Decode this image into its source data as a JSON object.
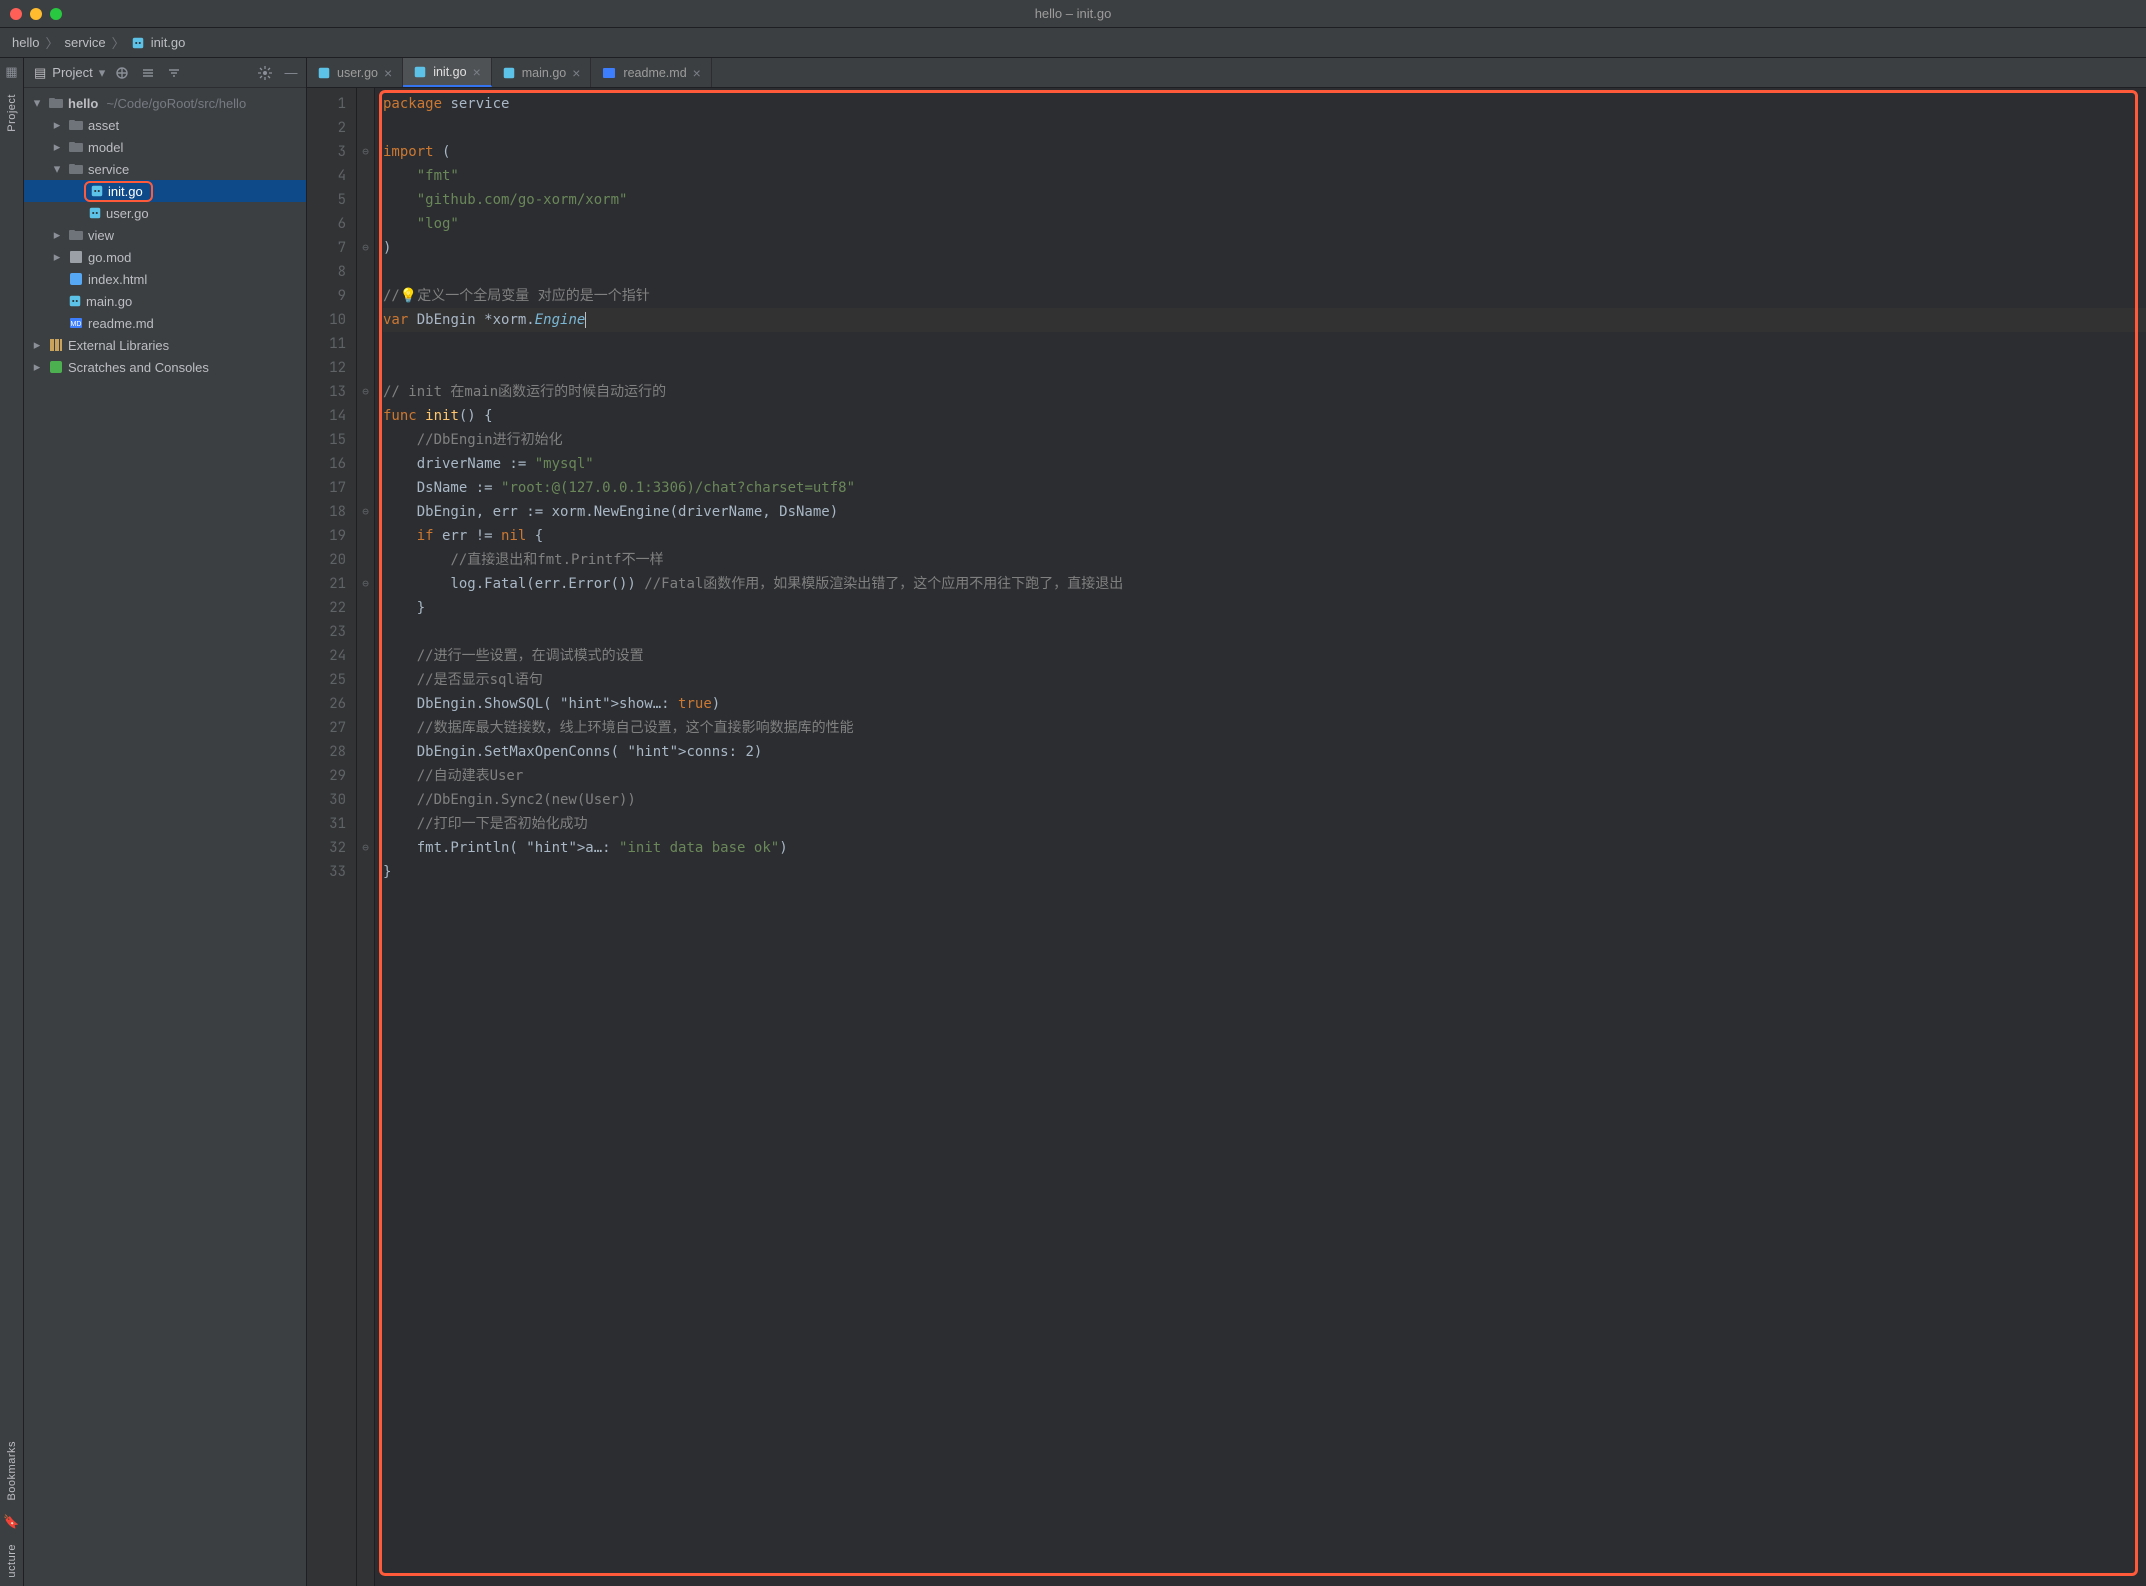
{
  "window": {
    "title": "hello – init.go"
  },
  "breadcrumb": {
    "root": "hello",
    "mid": "service",
    "file": "init.go"
  },
  "sidebar": {
    "title": "Project",
    "tree": {
      "root": {
        "name": "hello",
        "path": "~/Code/goRoot/src/hello"
      },
      "items": [
        {
          "name": "asset"
        },
        {
          "name": "model"
        },
        {
          "name": "service",
          "children": [
            {
              "name": "init.go"
            },
            {
              "name": "user.go"
            }
          ]
        },
        {
          "name": "view"
        },
        {
          "name": "go.mod"
        },
        {
          "name": "index.html"
        },
        {
          "name": "main.go"
        },
        {
          "name": "readme.md"
        }
      ],
      "external": "External Libraries",
      "scratches": "Scratches and Consoles"
    }
  },
  "tabs": [
    {
      "label": "user.go"
    },
    {
      "label": "init.go",
      "active": true
    },
    {
      "label": "main.go"
    },
    {
      "label": "readme.md"
    }
  ],
  "rail": {
    "project": "Project",
    "bookmarks": "Bookmarks",
    "structure": "ucture"
  },
  "code": {
    "lines": [
      "package service",
      "",
      "import (",
      "    \"fmt\"",
      "    \"github.com/go-xorm/xorm\"",
      "    \"log\"",
      ")",
      "",
      "//💡定义一个全局变量 对应的是一个指针",
      "var DbEngin *xorm.Engine",
      "",
      "// init 在main函数运行的时候自动运行的",
      "func init() {",
      "    //DbEngin进行初始化",
      "    driverName := \"mysql\"",
      "    DsName := \"root:@(127.0.0.1:3306)/chat?charset=utf8\"",
      "    DbEngin, err := xorm.NewEngine(driverName, DsName)",
      "    if err != nil {",
      "        //直接退出和fmt.Printf不一样",
      "        log.Fatal(err.Error()) //Fatal函数作用，如果模版渲染出错了，这个应用不用往下跑了，直接退出",
      "    }",
      "",
      "    //进行一些设置，在调试模式的设置",
      "    //是否显示sql语句",
      "    DbEngin.ShowSQL( show…: true)",
      "    //数据库最大链接数，线上环境自己设置，这个直接影响数据库的性能",
      "    DbEngin.SetMaxOpenConns( conns: 2)",
      "    //自动建表User",
      "    //DbEngin.Sync2(new(User))",
      "    //打印一下是否初始化成功",
      "    fmt.Println( a…: \"init data base ok\")",
      "}",
      ""
    ]
  }
}
